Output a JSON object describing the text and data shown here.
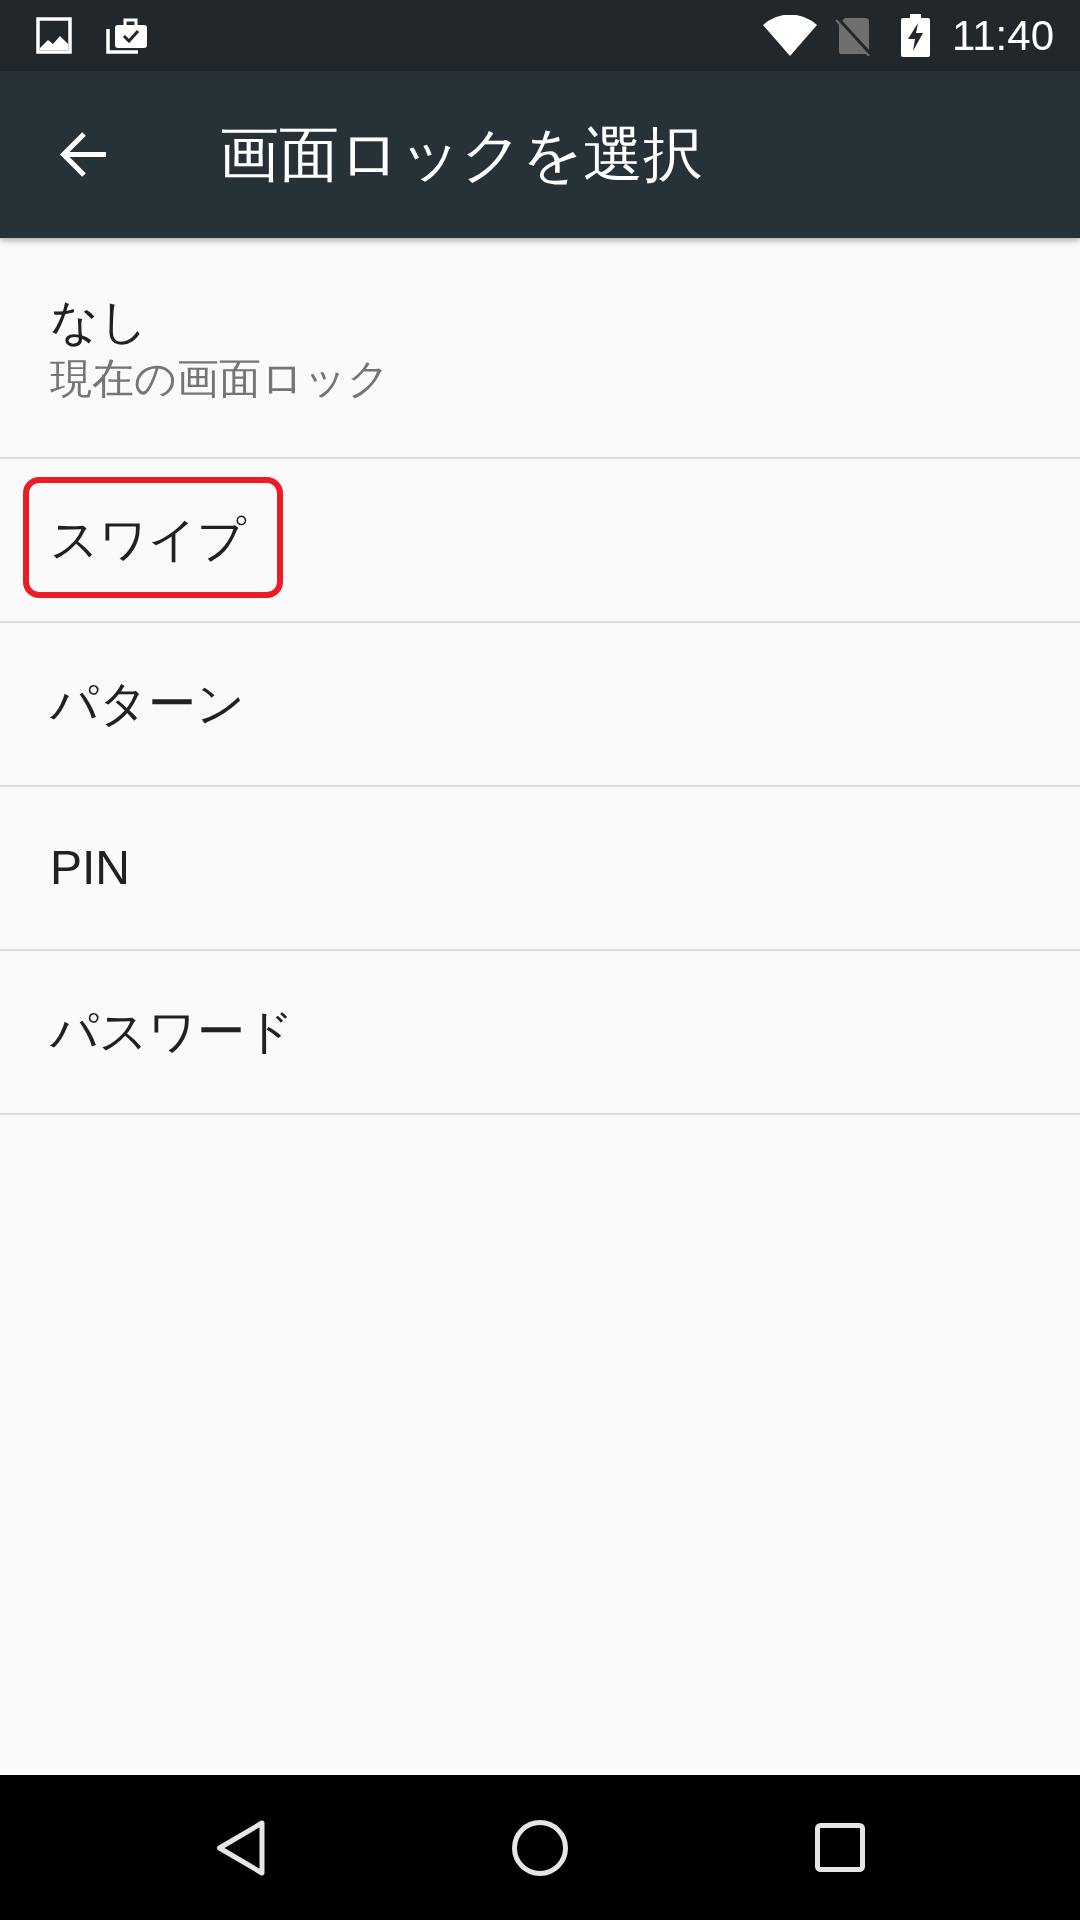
{
  "status_bar": {
    "time": "11:40"
  },
  "toolbar": {
    "title": "画面ロックを選択"
  },
  "items": [
    {
      "title": "なし",
      "subtitle": "現在の画面ロック",
      "highlighted": false
    },
    {
      "title": "スワイプ",
      "highlighted": true
    },
    {
      "title": "パターン",
      "highlighted": false
    },
    {
      "title": "PIN",
      "highlighted": false
    },
    {
      "title": "パスワード",
      "highlighted": false
    }
  ]
}
